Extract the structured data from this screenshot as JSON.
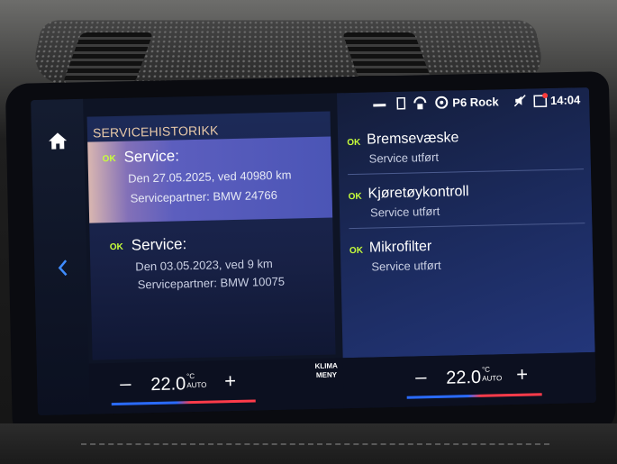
{
  "left_panel": {
    "title": "SERVICEHISTORIKK",
    "items": [
      {
        "ok": "OK",
        "title": "Service:",
        "line1": "Den 27.05.2025, ved 40980 km",
        "line2": "Servicepartner: BMW 24766"
      },
      {
        "ok": "OK",
        "title": "Service:",
        "line1": "Den 03.05.2023, ved 9 km",
        "line2": "Servicepartner: BMW 10075"
      }
    ]
  },
  "status_bar": {
    "radio": "P6 Rock",
    "time": "14:04"
  },
  "right_panel": {
    "items": [
      {
        "ok": "OK",
        "title": "Bremsevæske",
        "status": "Service utført"
      },
      {
        "ok": "OK",
        "title": "Kjøretøykontroll",
        "status": "Service utført"
      },
      {
        "ok": "OK",
        "title": "Mikrofilter",
        "status": "Service utført"
      }
    ]
  },
  "climate": {
    "left": {
      "minus": "–",
      "temp": "22.0",
      "unit": "°C",
      "mode": "AUTO",
      "plus": "+"
    },
    "right": {
      "minus": "–",
      "temp": "22.0",
      "unit": "°C",
      "mode": "AUTO",
      "plus": "+"
    },
    "menu_label_1": "KLIMA",
    "menu_label_2": "MENY"
  },
  "colors": {
    "ok_badge": "#c8ff3a",
    "title_accent": "#e8c9a8",
    "selection_highlight": "#5c5ebe"
  },
  "icons": [
    "home-icon",
    "back-chevron-icon",
    "sim-icon",
    "connectivity-icon",
    "radio-icon",
    "mute-icon",
    "notification-icon"
  ]
}
